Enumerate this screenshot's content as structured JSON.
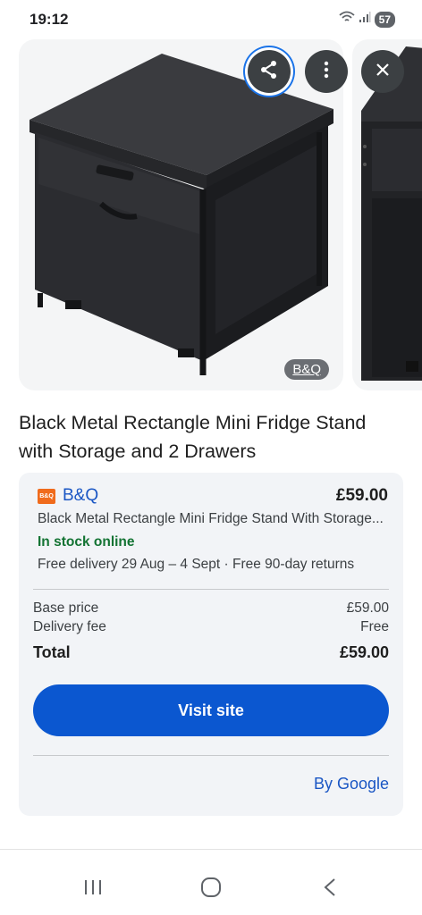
{
  "status_bar": {
    "time": "19:12",
    "battery": "57",
    "icons": [
      "wifi-icon",
      "signal-icon",
      "battery-icon"
    ]
  },
  "carousel": {
    "source_badge": "B&Q",
    "actions": [
      "share-icon",
      "more-vert-icon",
      "close-icon"
    ]
  },
  "product": {
    "title": "Black Metal Rectangle Mini Fridge Stand with Storage and 2 Drawers"
  },
  "offer": {
    "merchant_logo_text": "B&Q",
    "merchant_name": "B&Q",
    "price": "£59.00",
    "description": "Black Metal Rectangle Mini Fridge Stand With Storage...",
    "stock": "In stock online",
    "delivery": "Free delivery 29 Aug – 4 Sept · Free 90-day returns",
    "base_price_label": "Base price",
    "base_price_value": "£59.00",
    "delivery_fee_label": "Delivery fee",
    "delivery_fee_value": "Free",
    "total_label": "Total",
    "total_value": "£59.00",
    "visit_button": "Visit site",
    "attribution": "By Google"
  },
  "colors": {
    "accent_blue": "#0b57d0",
    "link_blue": "#1a56c4",
    "stock_green": "#137333",
    "merchant_orange": "#f06b1c"
  },
  "nav": {
    "buttons": [
      "recents-icon",
      "home-icon",
      "back-icon"
    ]
  }
}
